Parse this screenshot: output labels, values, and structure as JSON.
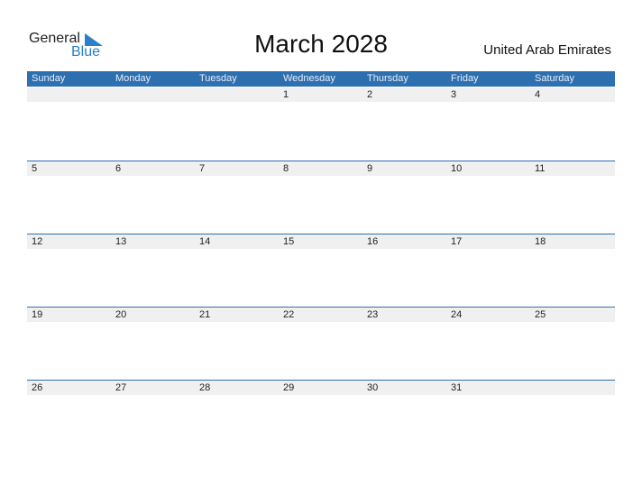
{
  "logo": {
    "line1": "General",
    "line2": "Blue"
  },
  "title": "March 2028",
  "country": "United Arab Emirates",
  "days": [
    "Sunday",
    "Monday",
    "Tuesday",
    "Wednesday",
    "Thursday",
    "Friday",
    "Saturday"
  ],
  "weeks": [
    [
      "",
      "",
      "",
      "1",
      "2",
      "3",
      "4"
    ],
    [
      "5",
      "6",
      "7",
      "8",
      "9",
      "10",
      "11"
    ],
    [
      "12",
      "13",
      "14",
      "15",
      "16",
      "17",
      "18"
    ],
    [
      "19",
      "20",
      "21",
      "22",
      "23",
      "24",
      "25"
    ],
    [
      "26",
      "27",
      "28",
      "29",
      "30",
      "31",
      ""
    ]
  ]
}
